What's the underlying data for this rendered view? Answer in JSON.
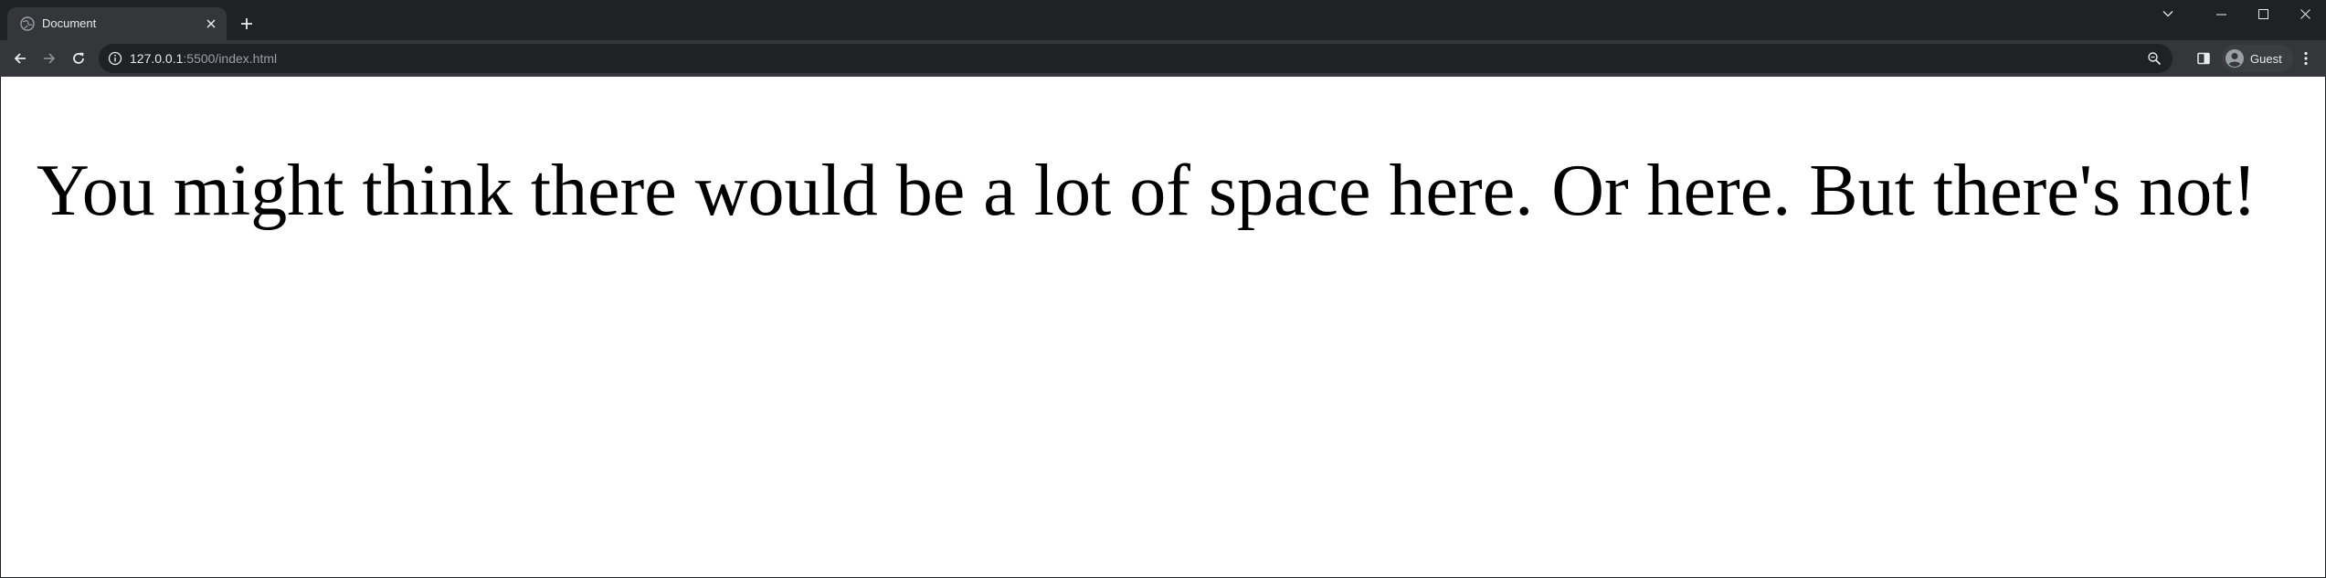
{
  "browser": {
    "tab": {
      "title": "Document",
      "favicon": "globe-icon"
    },
    "new_tab_icon": "plus-icon",
    "window_controls": [
      "tab-search-icon",
      "minimize-icon",
      "maximize-icon",
      "close-icon"
    ],
    "toolbar": {
      "back_icon": "back-arrow-icon",
      "forward_icon": "forward-arrow-icon",
      "reload_icon": "reload-icon",
      "url_host": "127.0.0.1",
      "url_rest": ":5500/index.html",
      "zoom_icon": "zoom-icon",
      "side_panel_icon": "side-panel-icon",
      "profile_label": "Guest",
      "menu_icon": "kebab-menu-icon"
    },
    "theme": {
      "frame": "#202124",
      "toolbar": "#35363a",
      "text": "#e8eaed",
      "muted_text": "#9aa0a6"
    }
  },
  "page": {
    "heading": "You might think there would be a lot of space here. Or here. But there's not!",
    "background": "#ffffff"
  }
}
